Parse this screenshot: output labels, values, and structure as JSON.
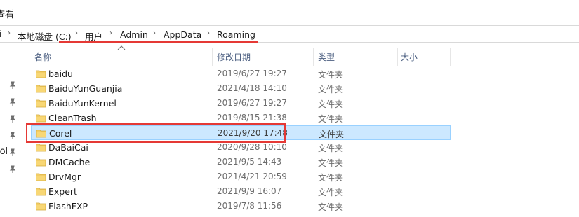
{
  "menu": {
    "view_label": "查看"
  },
  "address_bar": {
    "lead": "i",
    "crumbs": [
      "本地磁盘 (C:)",
      "用户",
      "Admin",
      "AppData",
      "Roaming"
    ]
  },
  "nav_pane": {
    "partial_label": "'ol"
  },
  "columns": {
    "name": "名称",
    "modified": "修改日期",
    "type": "类型",
    "size": "大小"
  },
  "files": [
    {
      "name": "baidu",
      "modified": "2019/6/27 19:27",
      "type": "文件夹"
    },
    {
      "name": "BaiduYunGuanjia",
      "modified": "2021/4/18 14:10",
      "type": "文件夹"
    },
    {
      "name": "BaiduYunKernel",
      "modified": "2019/6/27 19:27",
      "type": "文件夹"
    },
    {
      "name": "CleanTrash",
      "modified": "2019/8/15 21:38",
      "type": "文件夹"
    },
    {
      "name": "Corel",
      "modified": "2021/9/20 17:48",
      "type": "文件夹",
      "selected": true
    },
    {
      "name": "DaBaiCai",
      "modified": "2020/9/28 10:10",
      "type": "文件夹"
    },
    {
      "name": "DMCache",
      "modified": "2021/9/5 14:43",
      "type": "文件夹"
    },
    {
      "name": "DrvMgr",
      "modified": "2021/4/21 20:59",
      "type": "文件夹"
    },
    {
      "name": "Expert",
      "modified": "2021/9/9 16:07",
      "type": "文件夹"
    },
    {
      "name": "FlashFXP",
      "modified": "2019/7/8 11:56",
      "type": "文件夹"
    }
  ],
  "colors": {
    "selection_fill": "#cce8ff",
    "selection_border": "#99d1ff",
    "annotation_red": "#e53935",
    "folder_yellow": "#f8d775"
  }
}
